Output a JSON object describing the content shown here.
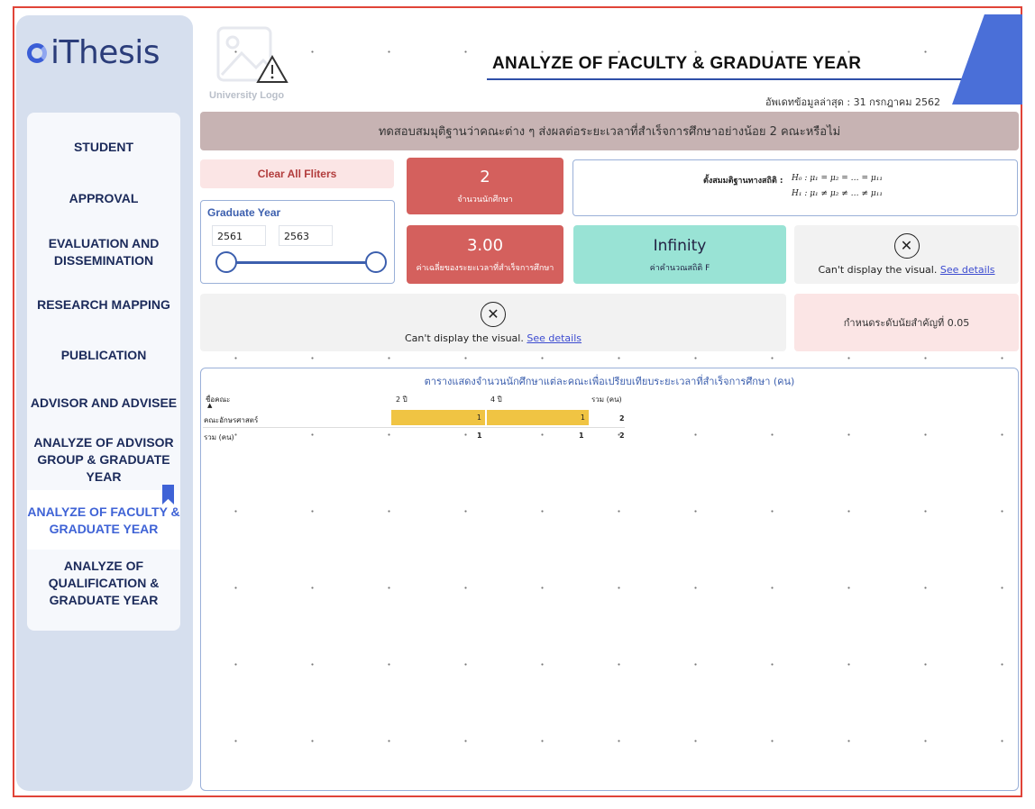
{
  "app": {
    "logo_text": "iThesis"
  },
  "sidebar": {
    "items": [
      {
        "label": "STUDENT"
      },
      {
        "label": "APPROVAL"
      },
      {
        "label": "EVALUATION AND DISSEMINATION"
      },
      {
        "label": "RESEARCH MAPPING"
      },
      {
        "label": "PUBLICATION"
      },
      {
        "label": "ADVISOR AND ADVISEE"
      },
      {
        "label": "ANALYZE OF ADVISOR GROUP & GRADUATE YEAR"
      },
      {
        "label": "ANALYZE OF FACULTY & GRADUATE YEAR",
        "active": true
      },
      {
        "label": "ANALYZE OF QUALIFICATION & GRADUATE YEAR"
      }
    ]
  },
  "header": {
    "uni_logo_label": "University Logo",
    "title": "ANALYZE OF FACULTY & GRADUATE YEAR",
    "update_text": "อัพเดทข้อมูลล่าสุด : 31 กรกฎาคม 2562"
  },
  "banner": {
    "text": "ทดสอบสมมุติฐานว่าคณะต่าง ๆ ส่งผลต่อระยะเวลาที่สำเร็จการศึกษาอย่างน้อย 2 คณะหรือไม่"
  },
  "filters": {
    "clear_label": "Clear All Fliters",
    "slicer_title": "Graduate Year",
    "from": "2561",
    "to": "2563"
  },
  "kpis": {
    "students": {
      "value": "2",
      "label": "จำนวนนักศึกษา"
    },
    "avg_time": {
      "value": "3.00",
      "label": "ค่าเฉลี่ยของระยะเวลาที่สำเร็จการศึกษา"
    },
    "f_stat": {
      "value": "Infinity",
      "label": "ค่าคำนวณสถิติ F"
    }
  },
  "hypothesis": {
    "label": "ตั้งสมมติฐานทางสถิติ :",
    "h0": "H₀ : μ₁ = μ₂ = … = μ₁₁",
    "h1": "H₁ : μ₁ ≠ μ₂ ≠ … ≠ μ₁₁"
  },
  "errors": {
    "message": "Can't display the visual.",
    "link": "See details"
  },
  "significance": {
    "text": "กำหนดระดับนัยสำคัญที่ 0.05"
  },
  "table": {
    "title": "ตารางแสดงจำนวนนักศึกษาแต่ละคณะเพื่อเปรียบเทียบระยะเวลาที่สำเร็จการศึกษา (คน)",
    "headers": [
      "ชื่อคณะ",
      "2 ปี",
      "4 ปี",
      "รวม (คน)"
    ],
    "rows": [
      {
        "name": "คณะอักษรศาสตร์",
        "y2": "1",
        "y4": "1",
        "total": "2"
      }
    ],
    "total_row": {
      "name": "รวม (คน)",
      "y2": "1",
      "y4": "1",
      "total": "2"
    }
  },
  "colors": {
    "accent": "#3f63d6",
    "kpi_red": "#d4605d",
    "kpi_green": "#99e3d5",
    "bar": "#f0c443",
    "banner": "#c7b3b3"
  }
}
